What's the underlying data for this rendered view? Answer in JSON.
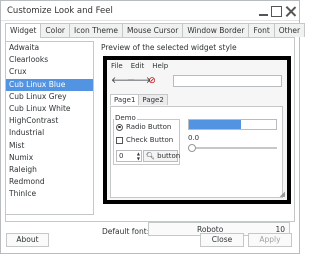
{
  "window": {
    "title": "Customize Look and Feel"
  },
  "tabs": [
    "Widget",
    "Color",
    "Icon Theme",
    "Mouse Cursor",
    "Window Border",
    "Font",
    "Other"
  ],
  "themes": [
    "Adwaita",
    "Clearlooks",
    "Crux",
    "Cub Linux Blue",
    "Cub Linux Grey",
    "Cub Linux White",
    "HighContrast",
    "Industrial",
    "Mist",
    "Numix",
    "Raleigh",
    "Redmond",
    "ThinIce"
  ],
  "selected_theme": "Cub Linux Blue",
  "preview": {
    "label": "Preview of the selected widget style",
    "menu": [
      "File",
      "Edit",
      "Help"
    ],
    "tabs": [
      "Page1",
      "Page2"
    ],
    "demo_label": "Demo",
    "radio_label": "Radio Button",
    "check_label": "Check Button",
    "spin_value": "0",
    "button_label": "button",
    "progress_text": "60 %",
    "progress_fraction": 0.6,
    "scale_value": "0.0"
  },
  "font": {
    "label": "Default font:",
    "name": "Roboto",
    "size": "10"
  },
  "buttons": {
    "about": "About",
    "close": "Close",
    "apply": "Apply"
  },
  "colors": {
    "accent": "#5294e2"
  }
}
